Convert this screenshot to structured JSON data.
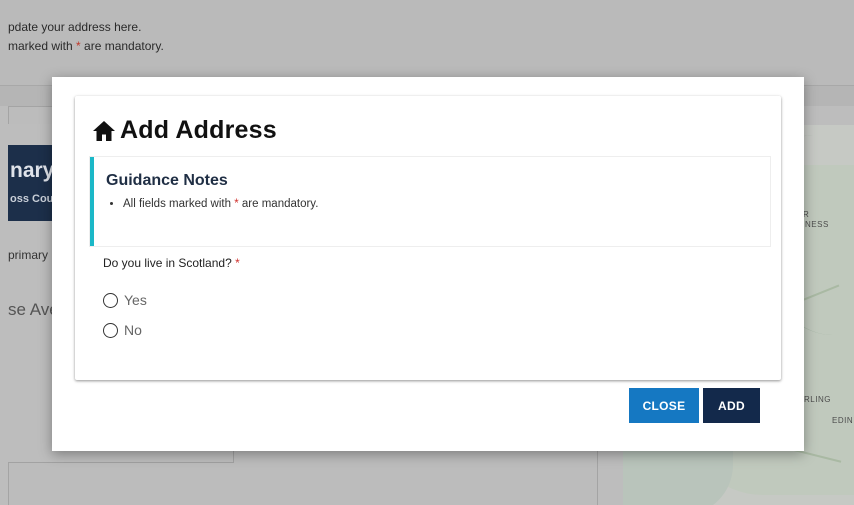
{
  "background": {
    "intro_line1": "pdate your address here.",
    "intro_line2_pre": "marked with ",
    "intro_line2_star": "*",
    "intro_line2_post": " are mandatory.",
    "primary_title": "nary",
    "primary_subtitle": "oss Cou",
    "primary_label": "primary",
    "address_fragment": "se Ave",
    "map_labels": {
      "top": "R",
      "ness": "NESS",
      "stirling": "RLING",
      "edin": "EDIN"
    }
  },
  "modal": {
    "title": "Add Address",
    "title_icon": "home-icon",
    "guidance": {
      "title": "Guidance Notes",
      "note_pre": "All fields marked with ",
      "note_star": "*",
      "note_post": " are mandatory."
    },
    "question": "Do you live in Scotland?",
    "question_star": "*",
    "options": [
      {
        "label": "Yes",
        "selected": false
      },
      {
        "label": "No",
        "selected": false
      }
    ],
    "buttons": {
      "close": "CLOSE",
      "add": "ADD"
    }
  },
  "colors": {
    "accent_teal": "#1bb8c8",
    "close_button": "#1578c2",
    "add_button": "#13294b",
    "required": "#d0312d"
  }
}
